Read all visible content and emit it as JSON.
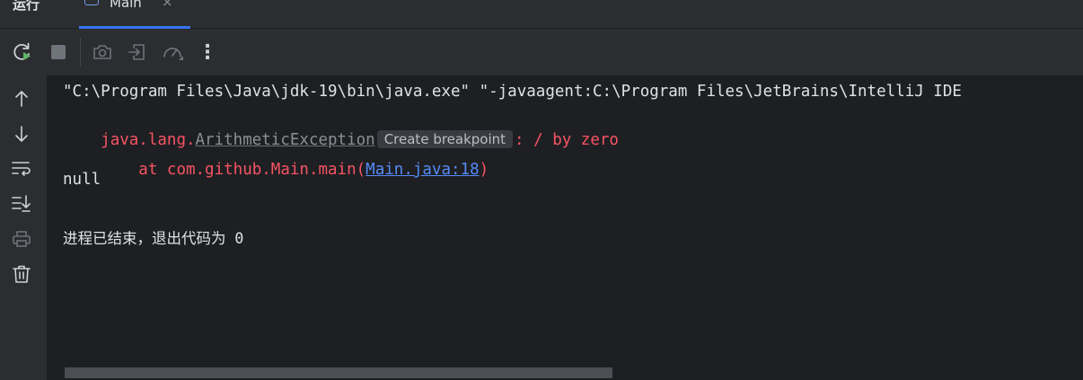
{
  "header": {
    "run_title": "运行",
    "tab_label": "Main",
    "tab_close": "×"
  },
  "toolbar": {
    "buttons": [
      "rerun-icon",
      "stop-icon",
      "screenshot-icon",
      "attach-debugger-icon",
      "profiler-icon",
      "more-options-icon"
    ],
    "more_label": "⋮"
  },
  "sidebar": {
    "buttons": [
      "arrow-up-icon",
      "arrow-down-icon",
      "soft-wrap-icon",
      "scroll-to-end-icon",
      "print-icon",
      "trash-icon"
    ]
  },
  "console": {
    "command": "\"C:\\Program Files\\Java\\jdk-19\\bin\\java.exe\" \"-javaagent:C:\\Program Files\\JetBrains\\IntelliJ IDE",
    "exception_prefix": "java.lang.",
    "exception_class": "ArithmeticException",
    "breakpoint_label": "Create breakpoint",
    "exception_message": ": / by zero",
    "stack_prefix": "    at com.github.Main.main(",
    "stack_link": "Main.java:18",
    "stack_suffix": ")",
    "output_null": "null",
    "exit_message": "进程已结束，退出代码为 0"
  },
  "colors": {
    "background": "#1e1f22",
    "panel": "#2b2d30",
    "error": "#f75464",
    "link": "#548af7",
    "accent": "#3574f0"
  }
}
